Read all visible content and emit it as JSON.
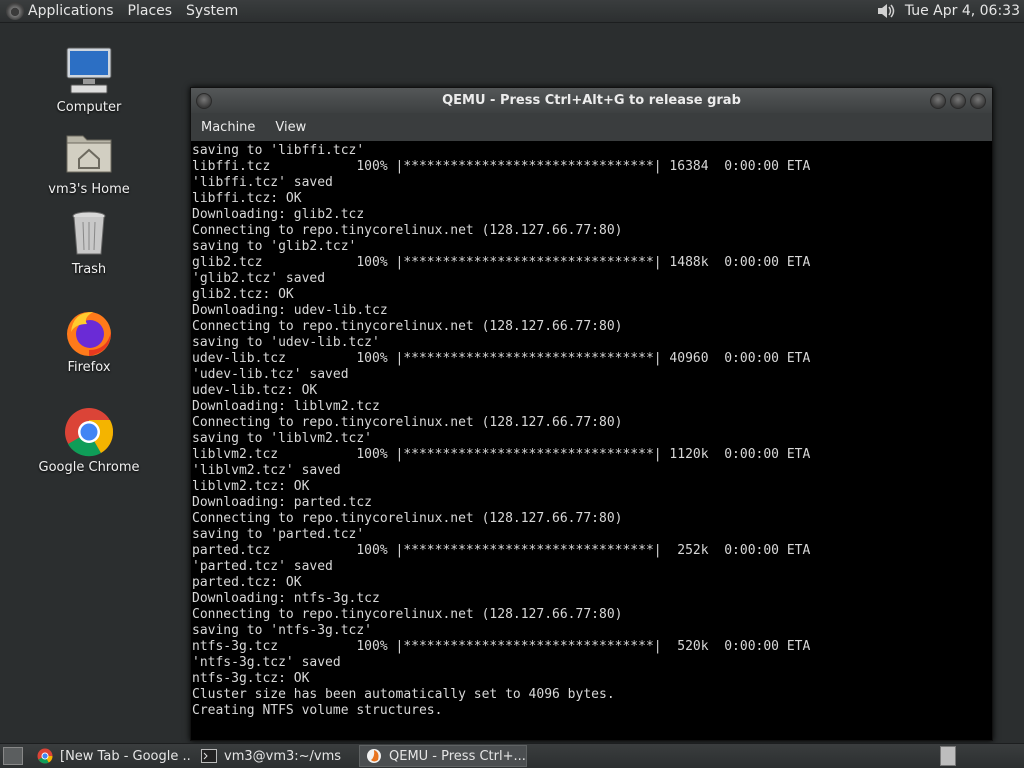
{
  "top_panel": {
    "menus": [
      "Applications",
      "Places",
      "System"
    ],
    "clock": "Tue Apr  4, 06:33"
  },
  "desktop": {
    "icons": [
      {
        "label": "Computer",
        "icon": "computer-icon"
      },
      {
        "label": "vm3's Home",
        "icon": "home-folder-icon"
      },
      {
        "label": "Trash",
        "icon": "trash-icon"
      },
      {
        "label": "Firefox",
        "icon": "firefox-icon"
      },
      {
        "label": "Google Chrome",
        "icon": "chrome-icon"
      }
    ]
  },
  "qemu": {
    "title": "QEMU - Press Ctrl+Alt+G to release grab",
    "menus": [
      "Machine",
      "View"
    ],
    "terminal_lines": [
      "saving to 'libffi.tcz'",
      "libffi.tcz           100% |********************************| 16384  0:00:00 ETA",
      "'libffi.tcz' saved",
      "libffi.tcz: OK",
      "Downloading: glib2.tcz",
      "Connecting to repo.tinycorelinux.net (128.127.66.77:80)",
      "saving to 'glib2.tcz'",
      "glib2.tcz            100% |********************************| 1488k  0:00:00 ETA",
      "'glib2.tcz' saved",
      "glib2.tcz: OK",
      "Downloading: udev-lib.tcz",
      "Connecting to repo.tinycorelinux.net (128.127.66.77:80)",
      "saving to 'udev-lib.tcz'",
      "udev-lib.tcz         100% |********************************| 40960  0:00:00 ETA",
      "'udev-lib.tcz' saved",
      "udev-lib.tcz: OK",
      "Downloading: liblvm2.tcz",
      "Connecting to repo.tinycorelinux.net (128.127.66.77:80)",
      "saving to 'liblvm2.tcz'",
      "liblvm2.tcz          100% |********************************| 1120k  0:00:00 ETA",
      "'liblvm2.tcz' saved",
      "liblvm2.tcz: OK",
      "Downloading: parted.tcz",
      "Connecting to repo.tinycorelinux.net (128.127.66.77:80)",
      "saving to 'parted.tcz'",
      "parted.tcz           100% |********************************|  252k  0:00:00 ETA",
      "'parted.tcz' saved",
      "parted.tcz: OK",
      "Downloading: ntfs-3g.tcz",
      "Connecting to repo.tinycorelinux.net (128.127.66.77:80)",
      "saving to 'ntfs-3g.tcz'",
      "ntfs-3g.tcz          100% |********************************|  520k  0:00:00 ETA",
      "'ntfs-3g.tcz' saved",
      "ntfs-3g.tcz: OK",
      "Cluster size has been automatically set to 4096 bytes.",
      "Creating NTFS volume structures."
    ]
  },
  "taskbar": {
    "tasks": [
      {
        "label": "[New Tab - Google ...",
        "icon": "chrome-icon"
      },
      {
        "label": "vm3@vm3:~/vms",
        "icon": "terminal-icon"
      },
      {
        "label": "QEMU - Press Ctrl+...",
        "icon": "qemu-icon"
      }
    ]
  }
}
